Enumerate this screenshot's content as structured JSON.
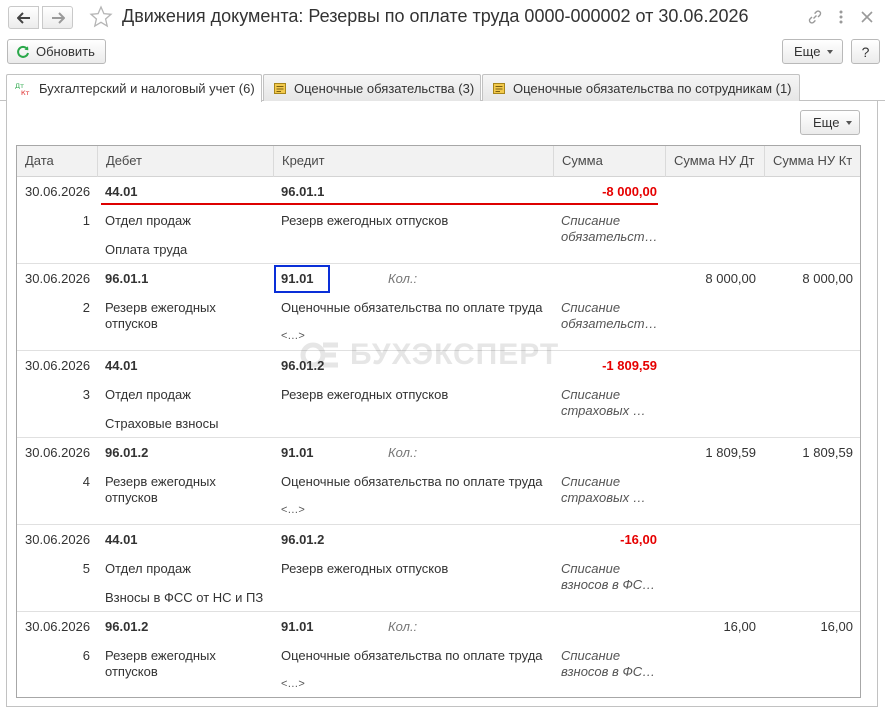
{
  "window": {
    "title": "Движения документа: Резервы по оплате труда 0000-000002 от 30.06.2026"
  },
  "toolbar": {
    "refresh_label": "Обновить",
    "more_label": "Еще",
    "help_label": "?"
  },
  "tabs": [
    {
      "label": "Бухгалтерский и налоговый учет (6)",
      "icon": "dt-kt-icon",
      "active": true
    },
    {
      "label": "Оценочные обязательства (3)",
      "icon": "register-icon",
      "active": false
    },
    {
      "label": "Оценочные обязательства по сотрудникам (1)",
      "icon": "register-icon",
      "active": false
    }
  ],
  "panel": {
    "more_label": "Еще"
  },
  "table": {
    "columns": [
      "Дата",
      "Дебет",
      "Кредит",
      "Сумма",
      "Сумма НУ Дт",
      "Сумма НУ Кт"
    ],
    "rows": [
      {
        "date": "30.06.2026",
        "num": "1",
        "debet": "44.01",
        "debet_sub1": "Отдел продаж",
        "debet_sub2": "Оплата труда",
        "kredit": "96.01.1",
        "kredit_sub1": "Резерв ежегодных отпусков",
        "kredit_sub2": "",
        "kol": "",
        "summa": "-8 000,00",
        "content": "Списание обязательст…",
        "nu_dt": "",
        "nu_kt": ""
      },
      {
        "date": "30.06.2026",
        "num": "2",
        "debet": "96.01.1",
        "debet_sub1": "Резерв ежегодных отпусков",
        "debet_sub2": "",
        "kredit": "91.01",
        "kredit_sub1": "Оценочные обязательства по оплате труда",
        "kredit_sub2": "<…>",
        "kol": "Кол.:",
        "summa": "",
        "content": "Списание обязательст…",
        "nu_dt": "8 000,00",
        "nu_kt": "8 000,00"
      },
      {
        "date": "30.06.2026",
        "num": "3",
        "debet": "44.01",
        "debet_sub1": "Отдел продаж",
        "debet_sub2": "Страховые взносы",
        "kredit": "96.01.2",
        "kredit_sub1": "Резерв ежегодных отпусков",
        "kredit_sub2": "",
        "kol": "",
        "summa": "-1 809,59",
        "content": "Списание страховых …",
        "nu_dt": "",
        "nu_kt": ""
      },
      {
        "date": "30.06.2026",
        "num": "4",
        "debet": "96.01.2",
        "debet_sub1": "Резерв ежегодных отпусков",
        "debet_sub2": "",
        "kredit": "91.01",
        "kredit_sub1": "Оценочные обязательства по оплате труда",
        "kredit_sub2": "<…>",
        "kol": "Кол.:",
        "summa": "",
        "content": "Списание страховых …",
        "nu_dt": "1 809,59",
        "nu_kt": "1 809,59"
      },
      {
        "date": "30.06.2026",
        "num": "5",
        "debet": "44.01",
        "debet_sub1": "Отдел продаж",
        "debet_sub2": "Взносы в ФСС от НС и ПЗ",
        "kredit": "96.01.2",
        "kredit_sub1": "Резерв ежегодных отпусков",
        "kredit_sub2": "",
        "kol": "",
        "summa": "-16,00",
        "content": "Списание взносов в ФС…",
        "nu_dt": "",
        "nu_kt": ""
      },
      {
        "date": "30.06.2026",
        "num": "6",
        "debet": "96.01.2",
        "debet_sub1": "Резерв ежегодных отпусков",
        "debet_sub2": "",
        "kredit": "91.01",
        "kredit_sub1": "Оценочные обязательства по оплате труда",
        "kredit_sub2": "<…>",
        "kol": "Кол.:",
        "summa": "",
        "content": "Списание взносов в ФС…",
        "nu_dt": "16,00",
        "nu_kt": "16,00"
      }
    ]
  },
  "watermark": "БУХЭКСПЕРТ",
  "colors": {
    "negative": "#e60000",
    "highlight_box": "#0a2fd8",
    "underline": "#dd0000",
    "refresh_icon": "#2aa84a"
  }
}
